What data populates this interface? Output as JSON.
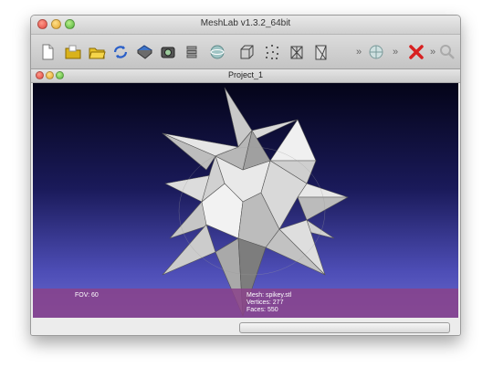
{
  "app": {
    "title": "MeshLab v1.3.2_64bit"
  },
  "toolbar": {
    "icons": [
      "new-file-icon",
      "open-folder-icon",
      "open-project-icon",
      "reload-icon",
      "save-icon",
      "snapshot-icon",
      "layers-icon",
      "render-sphere-icon",
      "bounding-box-icon",
      "points-icon",
      "wireframe-icon",
      "flat-lines-icon",
      "overflow-chevron-icon",
      "globe-icon",
      "overflow-chevron-icon",
      "delete-x-icon",
      "overflow-chevron-icon",
      "search-icon"
    ],
    "separator": "»"
  },
  "document": {
    "title": "Project_1"
  },
  "viewport": {
    "fov_label": "FOV: 60",
    "mesh_label": "Mesh: spikey.stl",
    "vertices_label": "Vertices: 277",
    "faces_label": "Faces: 550",
    "background_top": "#040418",
    "background_bottom": "#6a6ad0",
    "info_bar_color": "#8a428a"
  },
  "status": {
    "progress": 0
  }
}
